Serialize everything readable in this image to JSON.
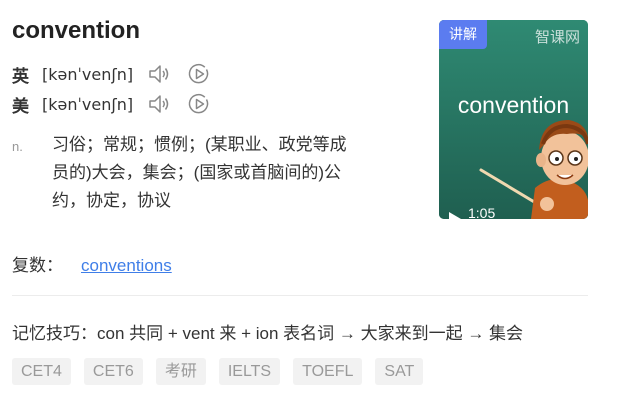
{
  "word": "convention",
  "pronunciations": [
    {
      "region": "英",
      "ipa": "[kənˈvenʃn]",
      "speaker_icon": "speaker-icon",
      "play_icon": "play-circle-icon"
    },
    {
      "region": "美",
      "ipa": "[kənˈvenʃn]",
      "speaker_icon": "speaker-icon",
      "play_icon": "play-circle-icon"
    }
  ],
  "definition": {
    "pos": "n.",
    "lines": [
      "习俗；常规；惯例；(某职业、政党等成",
      "员的)大会，集会；(国家或首脑间的)公",
      "约，协定，协议"
    ]
  },
  "plural": {
    "label": "复数：",
    "value": "conventions"
  },
  "mnemonic": "记忆技巧：con 共同 + vent 来 + ion 表名词 → 大家来到一起 → 集会",
  "tags": [
    "CET4",
    "CET6",
    "考研",
    "IELTS",
    "TOEFL",
    "SAT"
  ],
  "video": {
    "badge": "讲解",
    "brand": "智课网",
    "word": "convention",
    "duration": "1:05"
  },
  "colors": {
    "link": "#3f7ee8",
    "badge": "#5b7cf0",
    "video_bg": "#2e7d6b",
    "tag_bg": "#f2f2f2"
  }
}
